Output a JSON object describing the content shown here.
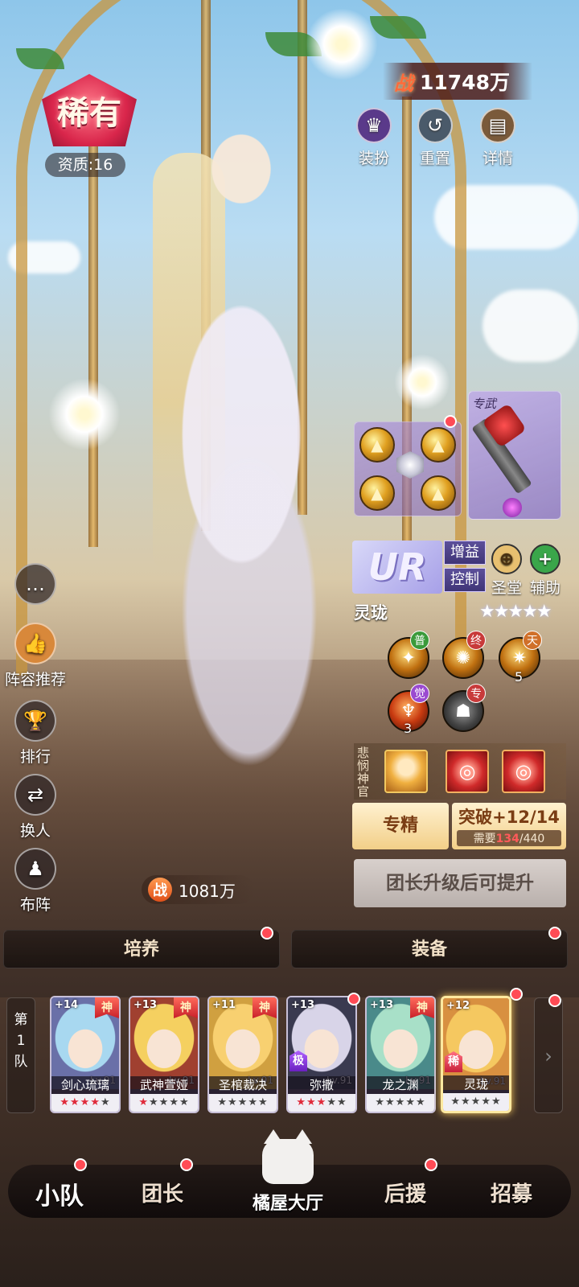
{
  "header": {
    "rarity": "稀有",
    "aptitude": "资质:16",
    "power_prefix": "战",
    "power_value": "11748万"
  },
  "top_buttons": [
    {
      "label": "装扮",
      "icon": "outfit-icon"
    },
    {
      "label": "重置",
      "icon": "reset-icon"
    },
    {
      "label": "详情",
      "icon": "book-icon"
    }
  ],
  "side_buttons": [
    {
      "label": "",
      "icon": "chat-icon"
    },
    {
      "label": "阵容推荐",
      "icon": "thumbs-up-icon"
    },
    {
      "label": "排行",
      "icon": "trophy-icon"
    },
    {
      "label": "换人",
      "icon": "swap-icon"
    },
    {
      "label": "布阵",
      "icon": "formation-icon"
    }
  ],
  "weapon": {
    "tag": "专武"
  },
  "hero": {
    "grade": "UR",
    "tags": [
      "增益",
      "控制"
    ],
    "classes": [
      {
        "label": "圣堂",
        "icon": "crosshair-icon",
        "color": "#e8c070"
      },
      {
        "label": "辅助",
        "icon": "plus-icon",
        "color": "#3aa64a"
      }
    ],
    "name": "灵珑",
    "stars": "★★★★★"
  },
  "skills": [
    {
      "tag": "普",
      "tag_color": "#3a9a3a",
      "level": ""
    },
    {
      "tag": "终",
      "tag_color": "#c83a3a",
      "level": ""
    },
    {
      "tag": "天",
      "tag_color": "#d0702a",
      "level": "5"
    },
    {
      "tag": "觉",
      "tag_color": "#9a4ad0",
      "level": "3"
    },
    {
      "tag": "专",
      "tag_color": "#c83a3a",
      "level": ""
    }
  ],
  "bond": {
    "title": "悲悯神官"
  },
  "actions": {
    "specialize": "专精",
    "breakthrough_title": "突破+12/14",
    "need_label": "需要",
    "need_current": "134",
    "need_total": "/440",
    "upgrade": "团长升级后可提升"
  },
  "team_power": {
    "prefix": "战",
    "value": "1081万"
  },
  "tabs": {
    "train": "培养",
    "equip": "装备"
  },
  "team_label": [
    "第",
    "1",
    "队"
  ],
  "roster": [
    {
      "plus": "+14",
      "god": "神",
      "name": "剑心琉璃",
      "lv": "Lv.91",
      "badge": "",
      "stars_red": "★★★★",
      "stars": "★",
      "hair": "#a8d8f0",
      "bg": "#6a70a8"
    },
    {
      "plus": "+13",
      "god": "神",
      "name": "武神萱娅",
      "lv": "Lv.91",
      "badge": "",
      "stars_red": "★",
      "stars": "★★★★",
      "hair": "#f5d060",
      "bg": "#a04030"
    },
    {
      "plus": "+11",
      "god": "神",
      "name": "圣棺裁决",
      "lv": "Lv.91",
      "badge": "",
      "stars_red": "",
      "stars": "★★★★★",
      "hair": "#f8d070",
      "bg": "#d0a040"
    },
    {
      "plus": "+13",
      "god": "",
      "name": "弥撒",
      "lv": "Lv.91",
      "badge": "极",
      "stars_red": "★★★",
      "stars": "★★",
      "hair": "#d8d4e8",
      "bg": "#3a3a50"
    },
    {
      "plus": "+13",
      "god": "神",
      "name": "龙之渊",
      "lv": "Lv.91",
      "badge": "",
      "stars_red": "",
      "stars": "★★★★★",
      "hair": "#a8e0c8",
      "bg": "#4a8a8a"
    },
    {
      "plus": "+12",
      "god": "",
      "name": "灵珑",
      "lv": "Lv.91",
      "badge": "稀",
      "stars_red": "",
      "stars": "★★★★★",
      "hair": "#f5c860",
      "bg": "#d89040"
    }
  ],
  "bottom_nav": [
    {
      "label": "小队",
      "active": true
    },
    {
      "label": "团长",
      "active": false
    },
    {
      "label": "橘屋大厅",
      "active": false
    },
    {
      "label": "后援",
      "active": false
    },
    {
      "label": "招募",
      "active": false
    }
  ],
  "colors": {
    "rarity_red": "#d9264b",
    "power_orange": "#ff6a3a",
    "notification_red": "#ff4b55",
    "ur_purple": "#a7a0e8",
    "gold_button": "#f2cf88"
  }
}
